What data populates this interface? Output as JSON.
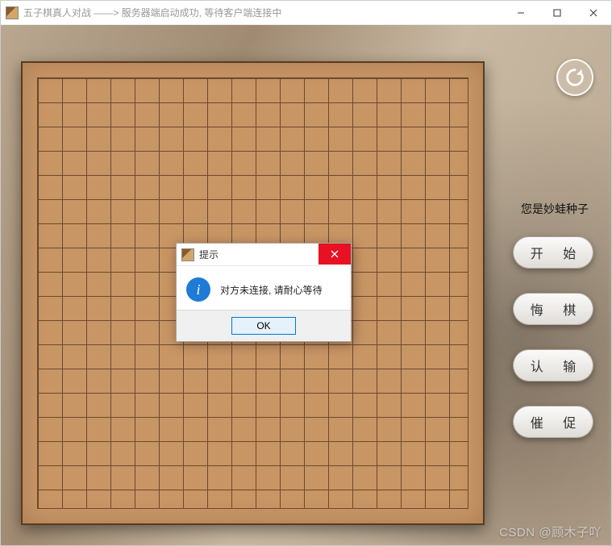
{
  "window": {
    "title": "五子棋真人对战  ——>  服务器端启动成功, 等待客户端连接中"
  },
  "side": {
    "player_label": "您是妙蛙种子",
    "buttons": {
      "start": "开 始",
      "undo": "悔 棋",
      "resign": "认 输",
      "urge": "催 促"
    }
  },
  "dialog": {
    "title": "提示",
    "message": "对方未连接, 请耐心等待",
    "ok_label": "OK"
  },
  "board": {
    "size": 19
  },
  "icons": {
    "refresh": "refresh-icon",
    "info": "info-icon",
    "close": "close-icon",
    "minimize": "minimize-icon",
    "maximize": "maximize-icon"
  },
  "watermark": "CSDN @顾木子吖"
}
